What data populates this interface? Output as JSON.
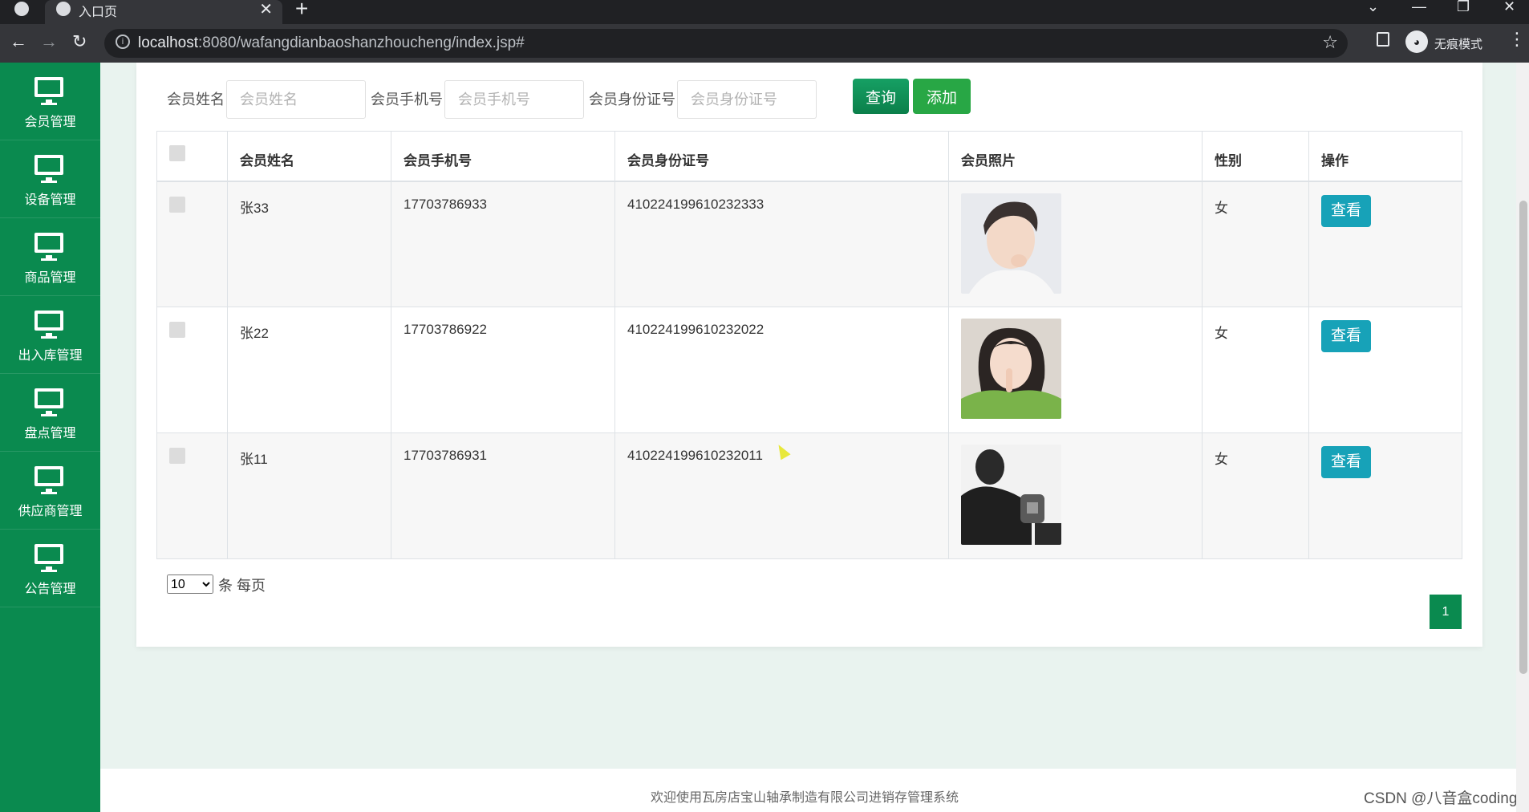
{
  "browser": {
    "tab_title": "入口页",
    "url_host": "localhost",
    "url_rest": ":8080/wafangdianbaoshanzhoucheng/index.jsp#",
    "incognito_label": "无痕模式"
  },
  "sidebar": {
    "items": [
      {
        "label": "会员管理",
        "icon": "monitor-icon"
      },
      {
        "label": "设备管理",
        "icon": "monitor-icon"
      },
      {
        "label": "商品管理",
        "icon": "monitor-icon"
      },
      {
        "label": "出入库管理",
        "icon": "monitor-icon"
      },
      {
        "label": "盘点管理",
        "icon": "monitor-icon"
      },
      {
        "label": "供应商管理",
        "icon": "monitor-icon"
      },
      {
        "label": "公告管理",
        "icon": "monitor-icon"
      }
    ]
  },
  "search": {
    "name_label": "会员姓名",
    "name_placeholder": "会员姓名",
    "phone_label": "会员手机号",
    "phone_placeholder": "会员手机号",
    "idcard_label": "会员身份证号",
    "idcard_placeholder": "会员身份证号",
    "query_button": "查询",
    "add_button": "添加"
  },
  "table": {
    "headers": [
      "会员姓名",
      "会员手机号",
      "会员身份证号",
      "会员照片",
      "性别",
      "操作"
    ],
    "rows": [
      {
        "name": "张33",
        "phone": "17703786933",
        "idcard": "410224199610232333",
        "gender": "女",
        "action": "查看"
      },
      {
        "name": "张22",
        "phone": "17703786922",
        "idcard": "410224199610232022",
        "gender": "女",
        "action": "查看"
      },
      {
        "name": "张11",
        "phone": "17703786931",
        "idcard": "410224199610232011",
        "gender": "女",
        "action": "查看"
      }
    ]
  },
  "pager": {
    "page_size": "10",
    "page_size_suffix": "条 每页",
    "current_page": "1"
  },
  "footer": {
    "text": "欢迎使用瓦房店宝山轴承制造有限公司进销存管理系统"
  },
  "watermark": "CSDN @八音盒coding",
  "colors": {
    "sidebar": "#0a8a4f",
    "query_button": "#0e8d55",
    "add_button": "#28a745",
    "view_button": "#17a2b8",
    "page_active": "#0a8a4f"
  }
}
